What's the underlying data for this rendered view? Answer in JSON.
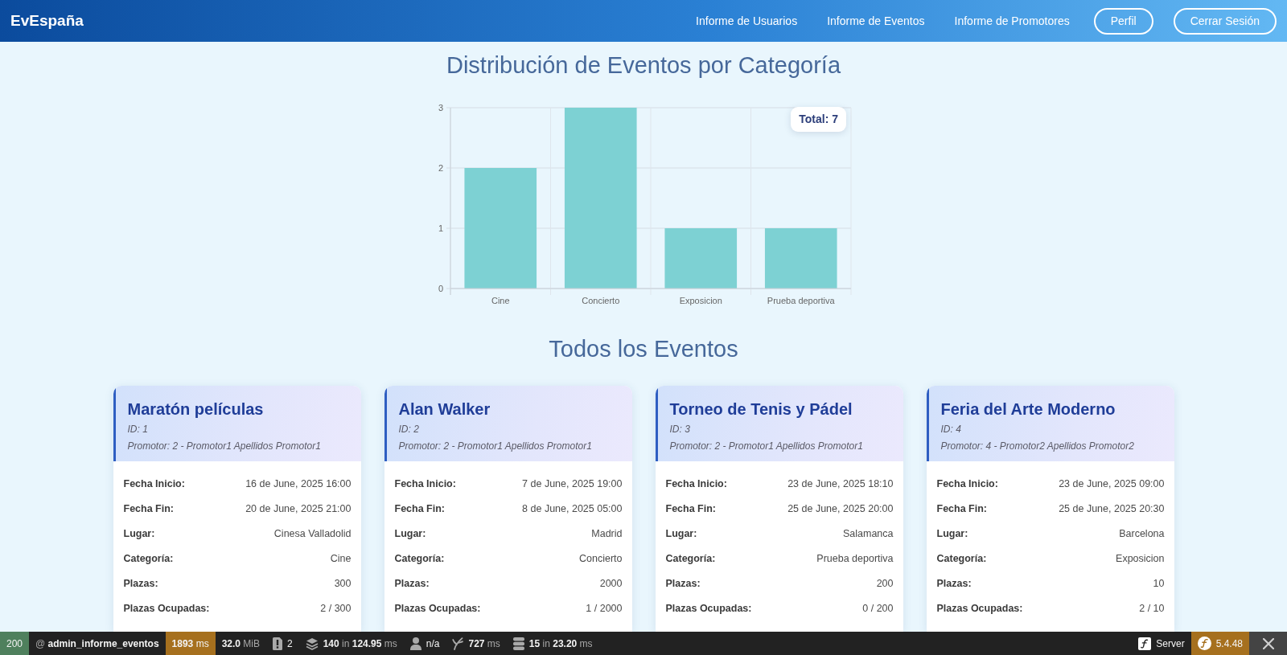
{
  "header": {
    "logo": "EvEspaña",
    "nav_links": [
      "Informe de Usuarios",
      "Informe de Eventos",
      "Informe de Promotores"
    ],
    "buttons": [
      "Perfil",
      "Cerrar Sesión"
    ]
  },
  "chart_section": {
    "title": "Distribución de Eventos por Categoría",
    "chart_data": {
      "type": "bar",
      "categories": [
        "Cine",
        "Concierto",
        "Exposicion",
        "Prueba deportiva"
      ],
      "values": [
        2,
        3,
        1,
        1
      ],
      "ylim": [
        0,
        3
      ],
      "yticks": [
        0,
        1,
        2,
        3
      ],
      "annotations": [
        {
          "text": "Total: 7"
        }
      ]
    }
  },
  "events_section": {
    "title": "Todos los Eventos",
    "events": [
      {
        "name": "Maratón películas",
        "id": "ID: 1",
        "promoter": "Promotor: 2 - Promotor1 Apellidos Promotor1",
        "fields": [
          {
            "label": "Fecha Inicio:",
            "value": "16 de June, 2025 16:00"
          },
          {
            "label": "Fecha Fin:",
            "value": "20 de June, 2025 21:00"
          },
          {
            "label": "Lugar:",
            "value": "Cinesa Valladolid"
          },
          {
            "label": "Categoría:",
            "value": "Cine"
          },
          {
            "label": "Plazas:",
            "value": "300"
          },
          {
            "label": "Plazas Ocupadas:",
            "value": "2 / 300"
          }
        ]
      },
      {
        "name": "Alan Walker",
        "id": "ID: 2",
        "promoter": "Promotor: 2 - Promotor1 Apellidos Promotor1",
        "fields": [
          {
            "label": "Fecha Inicio:",
            "value": "7 de June, 2025 19:00"
          },
          {
            "label": "Fecha Fin:",
            "value": "8 de June, 2025 05:00"
          },
          {
            "label": "Lugar:",
            "value": "Madrid"
          },
          {
            "label": "Categoría:",
            "value": "Concierto"
          },
          {
            "label": "Plazas:",
            "value": "2000"
          },
          {
            "label": "Plazas Ocupadas:",
            "value": "1 / 2000"
          }
        ]
      },
      {
        "name": "Torneo de Tenis y Pádel",
        "id": "ID: 3",
        "promoter": "Promotor: 2 - Promotor1 Apellidos Promotor1",
        "fields": [
          {
            "label": "Fecha Inicio:",
            "value": "23 de June, 2025 18:10"
          },
          {
            "label": "Fecha Fin:",
            "value": "25 de June, 2025 20:00"
          },
          {
            "label": "Lugar:",
            "value": "Salamanca"
          },
          {
            "label": "Categoría:",
            "value": "Prueba deportiva"
          },
          {
            "label": "Plazas:",
            "value": "200"
          },
          {
            "label": "Plazas Ocupadas:",
            "value": "0 / 200"
          }
        ]
      },
      {
        "name": "Feria del Arte Moderno",
        "id": "ID: 4",
        "promoter": "Promotor: 4 - Promotor2 Apellidos Promotor2",
        "fields": [
          {
            "label": "Fecha Inicio:",
            "value": "23 de June, 2025 09:00"
          },
          {
            "label": "Fecha Fin:",
            "value": "25 de June, 2025 20:30"
          },
          {
            "label": "Lugar:",
            "value": "Barcelona"
          },
          {
            "label": "Categoría:",
            "value": "Exposicion"
          },
          {
            "label": "Plazas:",
            "value": "10"
          },
          {
            "label": "Plazas Ocupadas:",
            "value": "2 / 10"
          }
        ]
      }
    ]
  },
  "debug_toolbar": {
    "items": [
      {
        "kind": "status",
        "text": "200"
      },
      {
        "kind": "route",
        "text": "@ **admin_informe_eventos**"
      },
      {
        "kind": "time",
        "text": "**1893** ms"
      },
      {
        "kind": "memory",
        "text": "**32.0** MiB"
      },
      {
        "kind": "logs",
        "text": "2"
      },
      {
        "kind": "events",
        "text": "**140** in **124.95** ms"
      },
      {
        "kind": "security",
        "text": "n/a"
      },
      {
        "kind": "twig",
        "text": "**727** ms"
      },
      {
        "kind": "database",
        "text": "**15** in **23.20** ms"
      }
    ],
    "right_items": [
      {
        "kind": "server",
        "text": "Server"
      },
      {
        "kind": "version",
        "text": "5.4.48"
      }
    ]
  }
}
